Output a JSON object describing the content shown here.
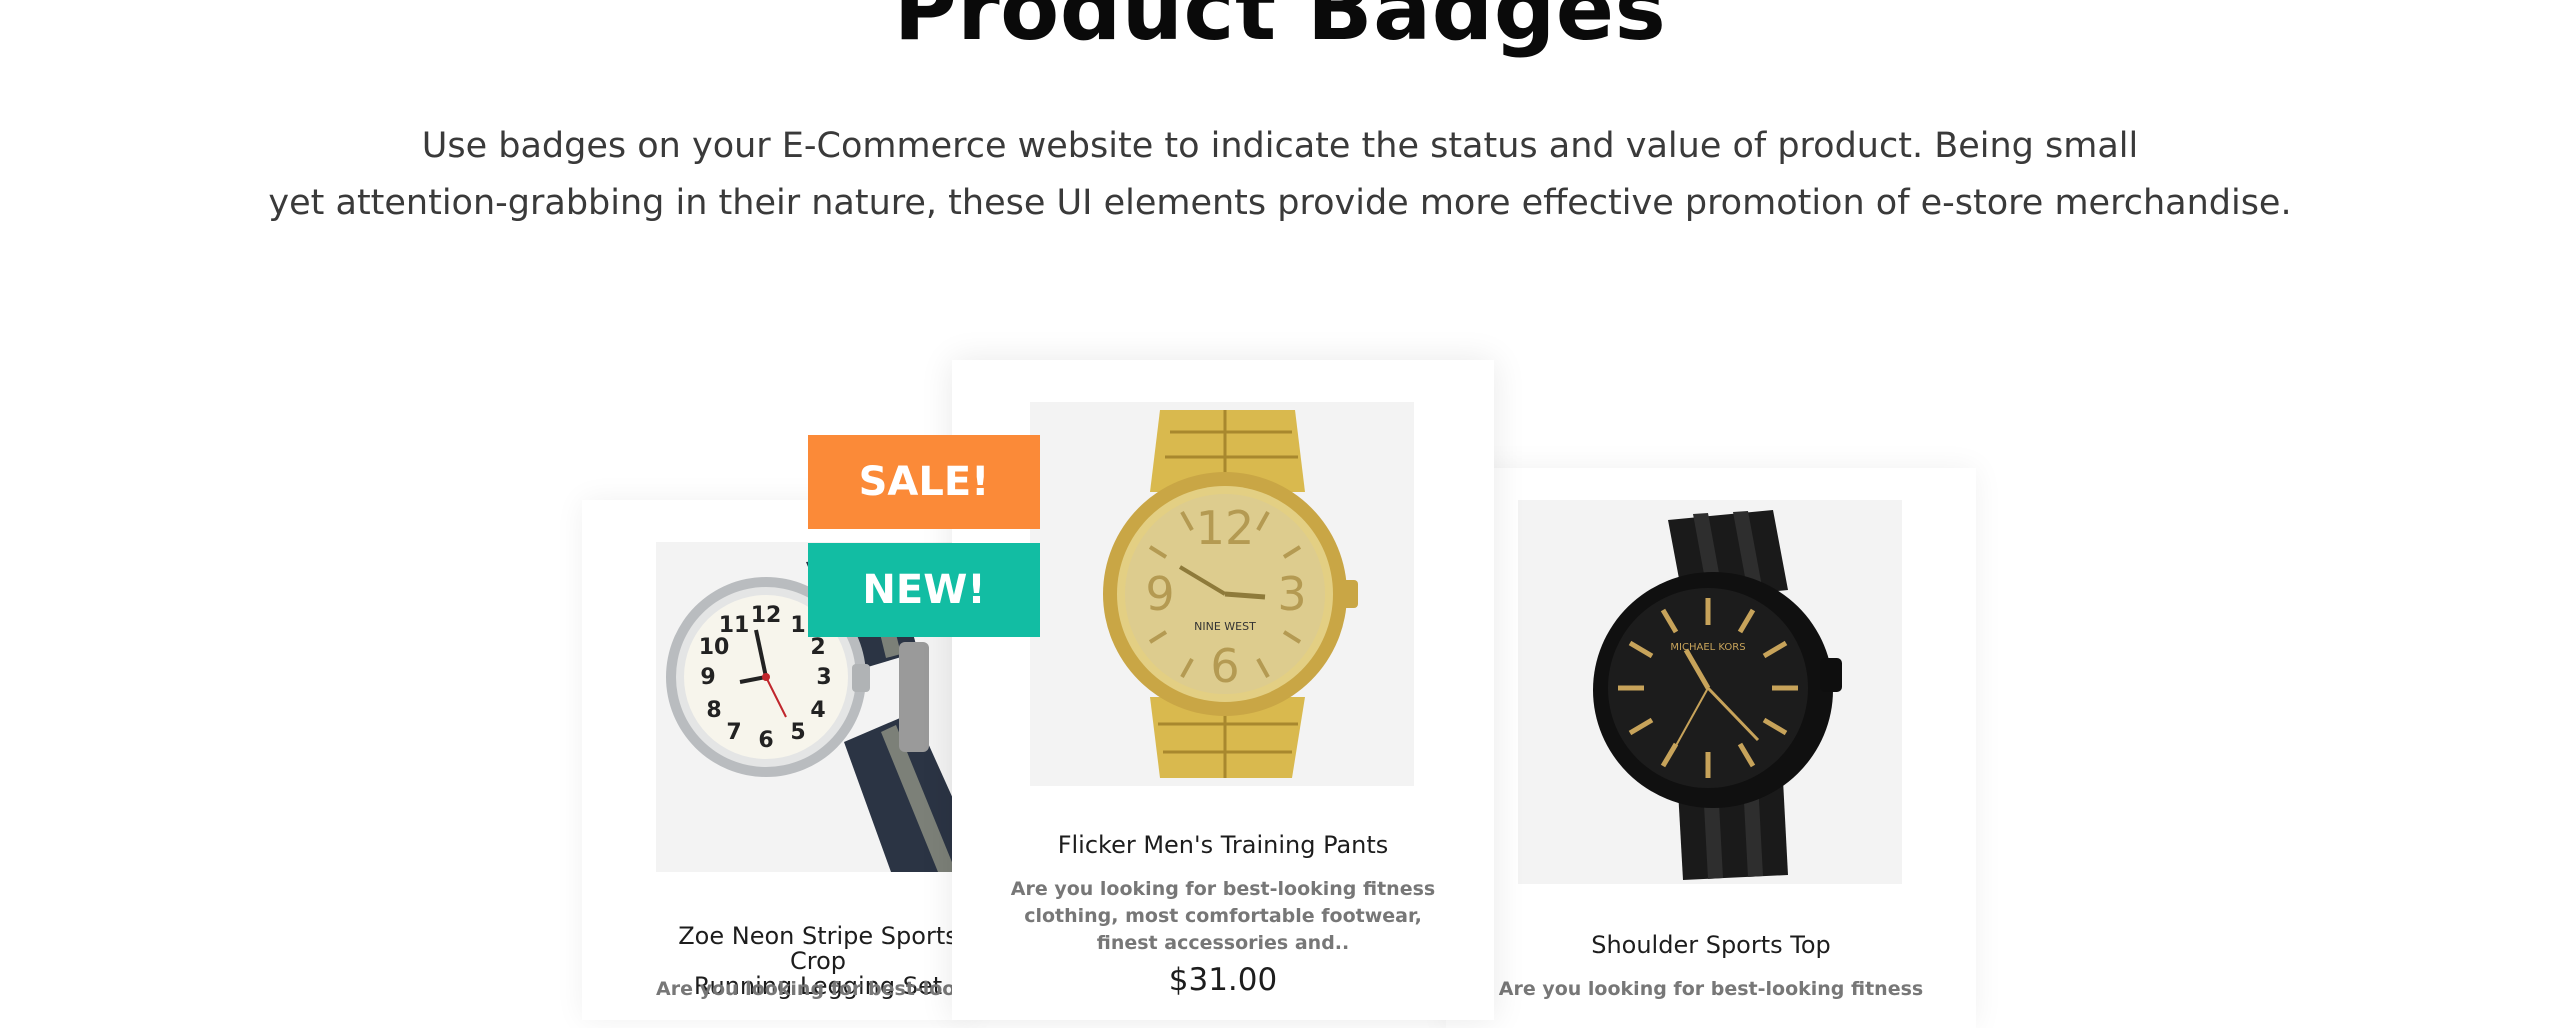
{
  "heading": {
    "title": "Product Badges",
    "line1": "Use badges on your E-Commerce website to indicate the status and value of product. Being small",
    "line2": "yet attention-grabbing in their nature, these UI elements provide more effective promotion of e-store merchandise."
  },
  "badges": {
    "sale": "SALE!",
    "new": "NEW!",
    "sale_color": "#FB8A38",
    "new_color": "#12BDA3"
  },
  "products": [
    {
      "name_line1": "Zoe Neon Stripe Sports Crop",
      "name_line2": "Running Legging Set",
      "desc": "Are you looking for best-looking fitn",
      "icon": "analog-watch-nato-strap"
    },
    {
      "name": "Flicker Men's Training Pants",
      "desc_line1": "Are you looking for best-looking fitness",
      "desc_line2": "clothing, most comfortable footwear,",
      "desc_line3": "finest accessories and..",
      "price": "$31.00",
      "icon": "gold-watch",
      "dial_brand": "NINE WEST"
    },
    {
      "name": "Shoulder Sports Top",
      "desc": "Are you looking for best-looking fitness",
      "icon": "black-watch",
      "dial_brand": "MICHAEL KORS"
    }
  ]
}
